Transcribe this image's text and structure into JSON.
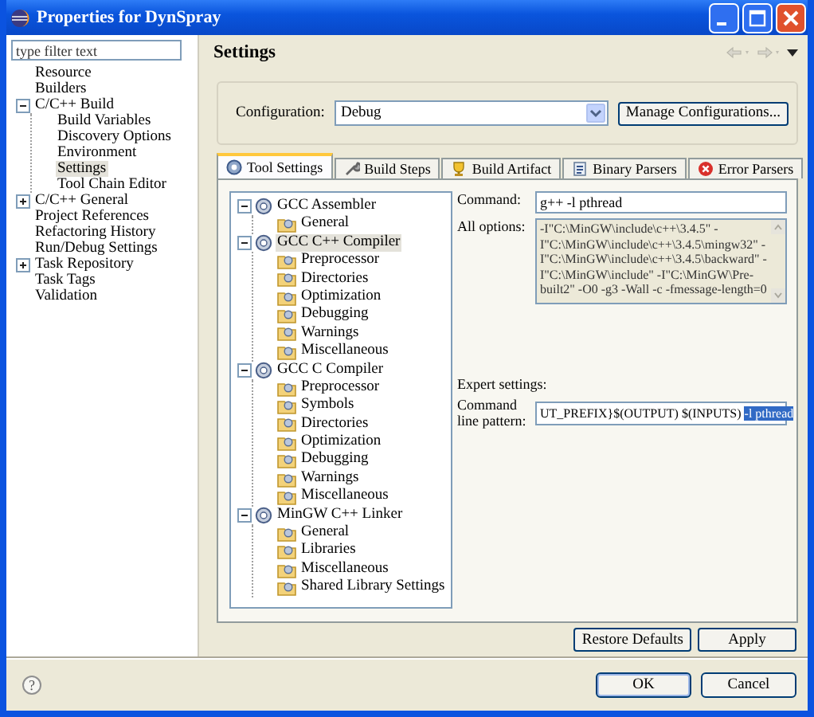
{
  "window": {
    "title": "Properties for DynSpray"
  },
  "filter": {
    "placeholder": "type filter text"
  },
  "nav": [
    {
      "label": "Resource",
      "selected": false
    },
    {
      "label": "Builders",
      "selected": false
    },
    {
      "label": "C/C++ Build",
      "expanded": true,
      "selected": false,
      "children": [
        {
          "label": "Build Variables",
          "selected": false
        },
        {
          "label": "Discovery Options",
          "selected": false
        },
        {
          "label": "Environment",
          "selected": false
        },
        {
          "label": "Settings",
          "selected": true
        },
        {
          "label": "Tool Chain Editor",
          "selected": false
        }
      ]
    },
    {
      "label": "C/C++ General",
      "expanded": false,
      "selected": false
    },
    {
      "label": "Project References",
      "selected": false
    },
    {
      "label": "Refactoring History",
      "selected": false
    },
    {
      "label": "Run/Debug Settings",
      "selected": false
    },
    {
      "label": "Task Repository",
      "expanded": false,
      "selected": false
    },
    {
      "label": "Task Tags",
      "selected": false
    },
    {
      "label": "Validation",
      "selected": false
    }
  ],
  "page": {
    "title": "Settings"
  },
  "configuration": {
    "label": "Configuration:",
    "value": "Debug",
    "button": "Manage Configurations..."
  },
  "tabs": [
    {
      "label": "Tool Settings",
      "kind": "gear",
      "selected": true
    },
    {
      "label": "Build Steps",
      "kind": "wrench",
      "selected": false
    },
    {
      "label": "Build Artifact",
      "kind": "trophy",
      "selected": false
    },
    {
      "label": "Binary Parsers",
      "kind": "binary",
      "selected": false
    },
    {
      "label": "Error Parsers",
      "kind": "error",
      "selected": false
    }
  ],
  "tools": [
    {
      "label": "GCC Assembler",
      "kind": "tool",
      "expanded": true,
      "selected": false,
      "children": [
        {
          "label": "General",
          "kind": "option",
          "selected": false
        }
      ]
    },
    {
      "label": "GCC C++ Compiler",
      "kind": "tool",
      "expanded": true,
      "selected": true,
      "children": [
        {
          "label": "Preprocessor",
          "kind": "option",
          "selected": false
        },
        {
          "label": "Directories",
          "kind": "option",
          "selected": false
        },
        {
          "label": "Optimization",
          "kind": "option",
          "selected": false
        },
        {
          "label": "Debugging",
          "kind": "option",
          "selected": false
        },
        {
          "label": "Warnings",
          "kind": "option",
          "selected": false
        },
        {
          "label": "Miscellaneous",
          "kind": "option",
          "selected": false
        }
      ]
    },
    {
      "label": "GCC C Compiler",
      "kind": "tool",
      "expanded": true,
      "selected": false,
      "children": [
        {
          "label": "Preprocessor",
          "kind": "option",
          "selected": false
        },
        {
          "label": "Symbols",
          "kind": "option",
          "selected": false
        },
        {
          "label": "Directories",
          "kind": "option",
          "selected": false
        },
        {
          "label": "Optimization",
          "kind": "option",
          "selected": false
        },
        {
          "label": "Debugging",
          "kind": "option",
          "selected": false
        },
        {
          "label": "Warnings",
          "kind": "option",
          "selected": false
        },
        {
          "label": "Miscellaneous",
          "kind": "option",
          "selected": false
        }
      ]
    },
    {
      "label": "MinGW C++ Linker",
      "kind": "tool",
      "expanded": true,
      "selected": false,
      "children": [
        {
          "label": "General",
          "kind": "option",
          "selected": false
        },
        {
          "label": "Libraries",
          "kind": "option",
          "selected": false
        },
        {
          "label": "Miscellaneous",
          "kind": "option",
          "selected": false
        },
        {
          "label": "Shared Library Settings",
          "kind": "option",
          "selected": false
        }
      ]
    }
  ],
  "command": {
    "label": "Command:",
    "value": "g++ -l pthread"
  },
  "all_options": {
    "label": "All options:",
    "text": "-I\"C:\\MinGW\\include\\c++\\3.4.5\" -I\"C:\\MinGW\\include\\c++\\3.4.5\\mingw32\" -I\"C:\\MinGW\\include\\c++\\3.4.5\\backward\" -I\"C:\\MinGW\\include\" -I\"C:\\MinGW\\Pre-built2\" -O0 -g3 -Wall -c -fmessage-length=0"
  },
  "expert_settings": {
    "label": "Expert settings:"
  },
  "command_line_pattern": {
    "label": "Command line pattern:",
    "value": "UT_PREFIX}$(OUTPUT) $(INPUTS) ",
    "selected_text": "-l pthread"
  },
  "page_buttons": [
    "Restore Defaults",
    "Apply"
  ],
  "help": {
    "symbol": "?"
  },
  "dialog_buttons": [
    "OK",
    "Cancel"
  ]
}
